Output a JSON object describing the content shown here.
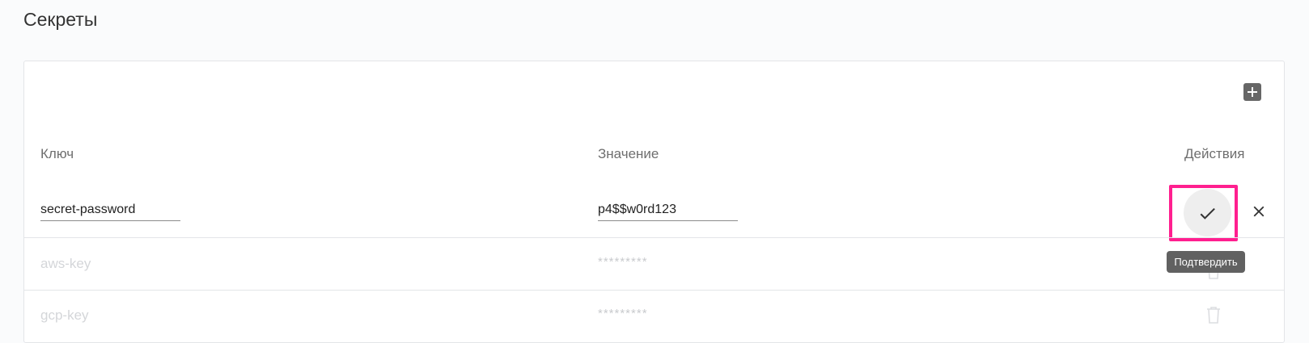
{
  "page": {
    "title": "Секреты"
  },
  "toolbar": {
    "add_icon": "plus-box-icon"
  },
  "table": {
    "headers": {
      "key": "Ключ",
      "value": "Значение",
      "actions": "Действия"
    },
    "editing_row": {
      "key": "secret-password",
      "value": "p4$$w0rd123",
      "confirm_icon": "check-icon",
      "cancel_icon": "close-icon"
    },
    "rows": [
      {
        "key": "aws-key",
        "value": "*********",
        "action_icon": "trash-icon"
      },
      {
        "key": "gcp-key",
        "value": "*********",
        "action_icon": "trash-icon"
      }
    ]
  },
  "tooltip": {
    "text": "Подтвердить"
  },
  "colors": {
    "highlight": "#ff1f8f",
    "add_button": "#666666",
    "tooltip_bg": "#616161"
  }
}
